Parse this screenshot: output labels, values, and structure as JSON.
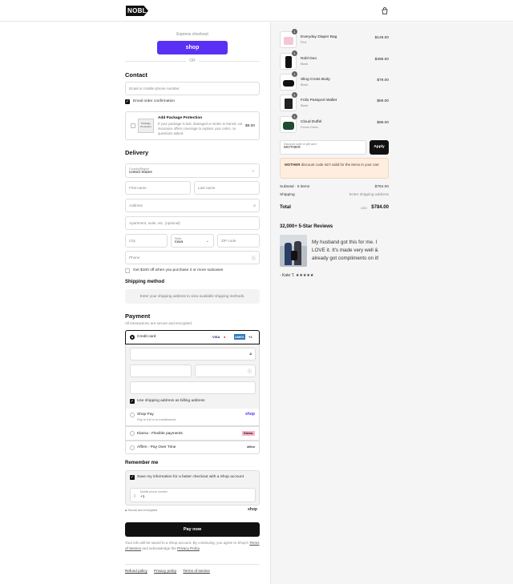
{
  "header": {
    "logo": "NOBL",
    "cart_icon": "shopping-bag-icon"
  },
  "express": {
    "title": "Express checkout",
    "shop_label": "shop",
    "or_label": "OR"
  },
  "contact": {
    "heading": "Contact",
    "email_placeholder": "Email or mobile phone number",
    "order_confirm_label": "Email order confirmation"
  },
  "package_protection": {
    "title": "Add Package Protection",
    "description": "If your package is lost, damaged or stolen in transit, our insurance offers coverage to replace your order, no questions asked.",
    "price": "$9.00",
    "img_text": "Package Protection"
  },
  "delivery": {
    "heading": "Delivery",
    "country_label": "Country/Region",
    "country_value": "United States",
    "first_name": "First name",
    "last_name": "Last name",
    "address": "Address",
    "apartment": "Apartment, suite, etc. (optional)",
    "city": "City",
    "state_label": "State",
    "state_value": "Iowa",
    "zip": "ZIP code",
    "phone": "Phone",
    "promo_label": "Get $100 off when you purchase 2 or more suitcases"
  },
  "shipping": {
    "heading": "Shipping method",
    "message": "Enter your shipping address to view available shipping methods."
  },
  "payment": {
    "heading": "Payment",
    "subtext": "All transactions are secure and encrypted.",
    "credit_card": "Credit card",
    "card_brands": [
      "VISA",
      "MC",
      "AMEX",
      "+1"
    ],
    "billing_label": "Use shipping address as billing address",
    "shop_pay": "Shop Pay",
    "shop_pay_sub": "Pay in full or in installments",
    "shop_pay_brand": "shop",
    "klarna": "Klarna - Flexible payments",
    "klarna_brand": "Klarna.",
    "affirm": "Affirm - Pay Over Time",
    "affirm_brand": "affirm"
  },
  "remember": {
    "heading": "Remember me",
    "save_label": "Save my information for a faster checkout with a Shop account",
    "phone_label": "Mobile phone number",
    "phone_value": "+1",
    "secure_label": "Secure and encrypted",
    "shop_brand": "shop"
  },
  "pay_now": "Pay now",
  "footer": {
    "info_pre": "Your info will be saved to a Shop account. By continuing, you agree to Shop's ",
    "terms": "Terms of Service",
    "info_mid": " and acknowledge the ",
    "privacy": "Privacy Policy",
    "info_post": ".",
    "links": [
      "Refund policy",
      "Privacy policy",
      "Terms of service"
    ]
  },
  "cart": {
    "items": [
      {
        "qty": "1",
        "name": "Everyday Diaper Bag",
        "variant": "Pink",
        "price": "$149.00"
      },
      {
        "qty": "1",
        "name": "Nobl Duo",
        "variant": "Black",
        "price": "$399.00"
      },
      {
        "qty": "1",
        "name": "Sling Cross Body",
        "variant": "Black",
        "price": "$79.00"
      },
      {
        "qty": "1",
        "name": "Folio Passport Wallet",
        "variant": "Black",
        "price": "$59.00"
      },
      {
        "qty": "1",
        "name": "Cloud Duffel",
        "variant": "Forest Green",
        "price": "$98.00"
      }
    ],
    "discount_label": "Discount code or gift card",
    "discount_value": "MOTHER",
    "apply_label": "Apply",
    "warning_code": "MOTHER",
    "warning_text": " discount code isn't valid for the items in your cart",
    "subtotal_label": "Subtotal · 5 items",
    "subtotal_value": "$784.00",
    "shipping_label": "Shipping",
    "shipping_value": "Enter shipping address",
    "total_label": "Total",
    "currency": "USD",
    "total_value": "$784.00"
  },
  "reviews": {
    "title": "32,000+ 5-Star Reviews",
    "text": "My husband got this for me. I LOVE it. It's made very well & already got compliments on it!",
    "author": "- Kate T. ★★★★★"
  },
  "colors": {
    "shop_purple": "#5a31f4",
    "warning_bg": "#fdeee0",
    "dark": "#111111"
  }
}
